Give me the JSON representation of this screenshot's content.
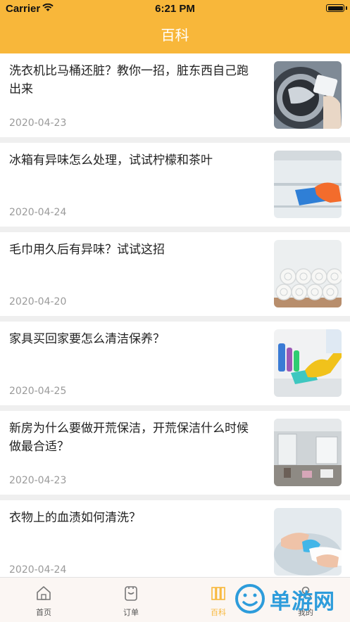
{
  "status": {
    "carrier": "Carrier",
    "time": "6:21 PM"
  },
  "nav": {
    "title": "百科"
  },
  "articles": [
    {
      "title": "洗衣机比马桶还脏？教你一招，脏东西自己跑出来",
      "date": "2020-04-23",
      "image": "washing-machine-image"
    },
    {
      "title": "冰箱有异味怎么处理，试试柠檬和茶叶",
      "date": "2020-04-24",
      "image": "fridge-cleaning-image"
    },
    {
      "title": "毛巾用久后有异味？试试这招",
      "date": "2020-04-20",
      "image": "rolled-towels-image"
    },
    {
      "title": "家具买回家要怎么清洁保养？",
      "date": "2020-04-25",
      "image": "table-cleaning-image"
    },
    {
      "title": "新房为什么要做开荒保洁，开荒保洁什么时候做最合适？",
      "date": "2020-04-23",
      "image": "empty-room-image"
    },
    {
      "title": "衣物上的血渍如何清洗？",
      "date": "2020-04-24",
      "image": "sink-washing-image"
    }
  ],
  "tabs": [
    {
      "label": "首页",
      "icon": "home-icon"
    },
    {
      "label": "订单",
      "icon": "order-icon"
    },
    {
      "label": "百科",
      "icon": "book-icon",
      "active": true
    },
    {
      "label": "我的",
      "icon": "user-icon"
    }
  ],
  "watermark": {
    "text": "单游网",
    "url": ".com"
  },
  "colors": {
    "accent": "#f8b73a",
    "background": "#efefef",
    "date": "#9a9a9a"
  }
}
